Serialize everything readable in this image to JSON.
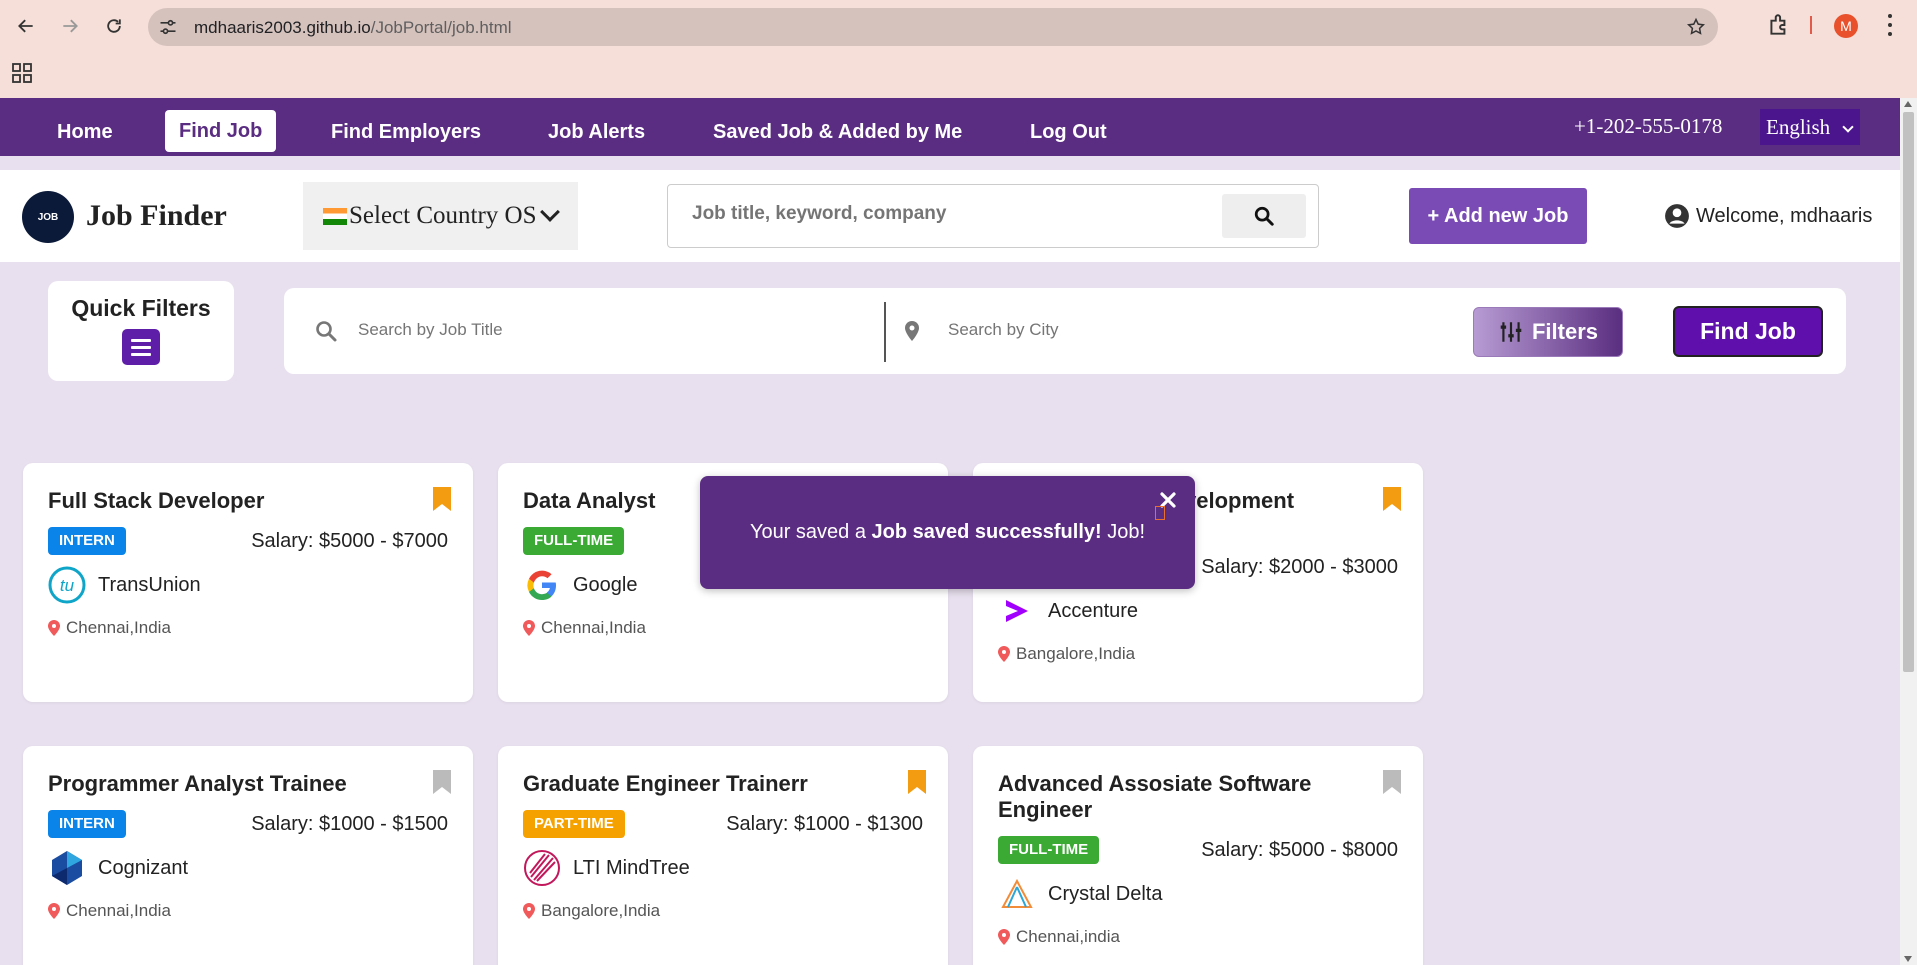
{
  "browser": {
    "url_host": "mdhaaris2003.github.io",
    "url_path": "/JobPortal/job.html",
    "profile_initial": "M"
  },
  "topnav": {
    "items": [
      "Home",
      "Find Job",
      "Find Employers",
      "Job Alerts",
      "Saved Job & Added by Me",
      "Log Out"
    ],
    "active": "Find Job",
    "phone": "+1-202-555-0178",
    "language": "English"
  },
  "header": {
    "logo_text": "JOB",
    "brand": "Job Finder",
    "country_select": "Select Country OS",
    "keyword_placeholder": "Job title, keyword, company",
    "add_job": "+ Add new Job",
    "welcome": "Welcome, mdhaaris"
  },
  "filters": {
    "quick_filters": "Quick Filters",
    "title_placeholder": "Search by Job Title",
    "city_placeholder": "Search by City",
    "filters_label": "Filters",
    "find_job": "Find Job"
  },
  "toast": {
    "prefix": "Your saved a ",
    "bold": "Job saved successfully!",
    "suffix": " Job!"
  },
  "jobs": [
    {
      "title": "Full Stack Developer",
      "type": "INTERN",
      "salary": "Salary: $5000 - $7000",
      "company": "TransUnion",
      "location": "Chennai,India",
      "saved": true
    },
    {
      "title": "Data Analyst",
      "type": "FULL-TIME",
      "salary": "",
      "company": "Google",
      "location": "Chennai,India",
      "saved": false
    },
    {
      "title": "velopment",
      "type": "",
      "salary": "Salary: $2000 - $3000",
      "company": "Accenture",
      "location": "Bangalore,India",
      "saved": true
    },
    {
      "title": "Programmer Analyst Trainee",
      "type": "INTERN",
      "salary": "Salary: $1000 - $1500",
      "company": "Cognizant",
      "location": "Chennai,India",
      "saved": false
    },
    {
      "title": "Graduate Engineer Trainerr",
      "type": "PART-TIME",
      "salary": "Salary: $1000 - $1300",
      "company": "LTI MindTree",
      "location": "Bangalore,India",
      "saved": true
    },
    {
      "title": "Advanced Assosiate Software Engineer",
      "type": "FULL-TIME",
      "salary": "Salary: $5000 - $8000",
      "company": "Crystal Delta",
      "location": "Chennai,india",
      "saved": false
    }
  ],
  "colors": {
    "nav_purple": "#5b2d82",
    "bookmark_saved": "#f39c12",
    "bookmark_unsaved": "#bbbbbb",
    "intern": "#0a84e8",
    "full_time": "#3aaa35",
    "part_time": "#f5a100"
  }
}
